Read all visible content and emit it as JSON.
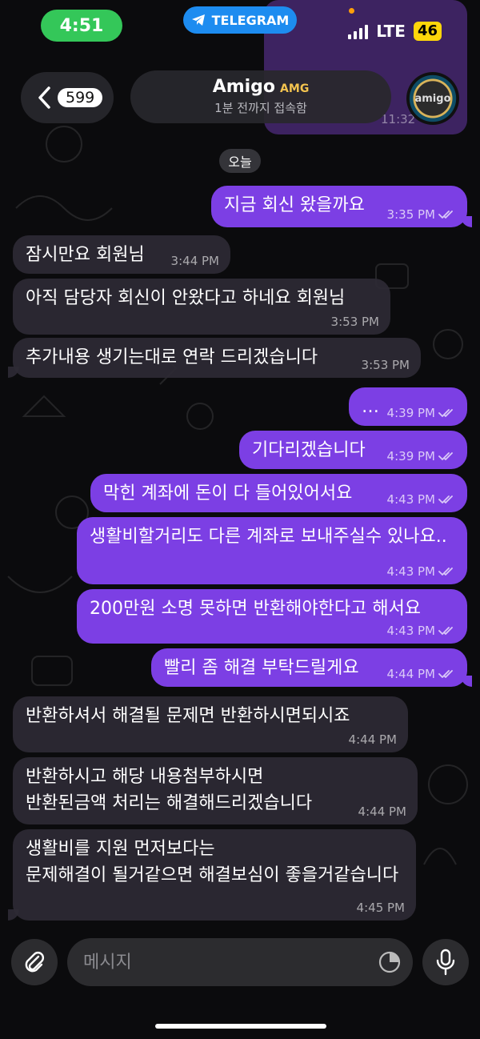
{
  "status_bar": {
    "time": "4:51",
    "app_indicator": "TELEGRAM",
    "network": "LTE",
    "battery": "46"
  },
  "header": {
    "back_count": "599",
    "title": "Amigo",
    "badge": "AMG",
    "subtitle": "1분 전까지 접속함",
    "avatar_text": "amigo"
  },
  "background_preview_time": "11:32",
  "date_label": "오늘",
  "messages": [
    {
      "dir": "out",
      "text": "지금 회신 왔을까요",
      "time": "3:35 PM",
      "read": true
    },
    {
      "dir": "in",
      "text": "잠시만요 회원님",
      "time": "3:44 PM"
    },
    {
      "dir": "in",
      "text": "아직 담당자 회신이 안왔다고 하네요 회원님",
      "time": "3:53 PM"
    },
    {
      "dir": "in",
      "text": "추가내용 생기는대로 연락 드리겠습니다",
      "time": "3:53 PM"
    },
    {
      "dir": "out",
      "text": "…",
      "time": "4:39 PM",
      "read": true
    },
    {
      "dir": "out",
      "text": "기다리겠습니다",
      "time": "4:39 PM",
      "read": true
    },
    {
      "dir": "out",
      "text": "막힌 계좌에 돈이 다 들어있어서요",
      "time": "4:43 PM",
      "read": true
    },
    {
      "dir": "out",
      "text": "생활비할거리도 다른 계좌로 보내주실수 있나요..",
      "time": "4:43 PM",
      "read": true
    },
    {
      "dir": "out",
      "text": "200만원 소명 못하면 반환해야한다고 해서요",
      "time": "4:43 PM",
      "read": true
    },
    {
      "dir": "out",
      "text": "빨리 좀 해결 부탁드릴게요",
      "time": "4:44 PM",
      "read": true
    },
    {
      "dir": "in",
      "text": "반환하셔서 해결될 문제면 반환하시면되시죠",
      "time": "4:44 PM"
    },
    {
      "dir": "in",
      "text": "반환하시고 해당 내용첨부하시면\n반환된금액 처리는 해결해드리겠습니다",
      "time": "4:44 PM"
    },
    {
      "dir": "in",
      "text": "생활비를 지원 먼저보다는\n문제해결이 될거같으면 해결보심이 좋을거같습니다",
      "time": "4:45 PM"
    }
  ],
  "composer": {
    "placeholder": "메시지"
  },
  "icons": {
    "back": "chevron-left-icon",
    "attach": "paperclip-icon",
    "sticker": "sticker-icon",
    "mic": "microphone-icon",
    "read": "double-check-icon",
    "telegram": "telegram-plane-icon"
  },
  "colors": {
    "outgoing_bubble": "#7c3fe4",
    "incoming_bubble": "#2e2a34",
    "status_time_pill": "#34c759",
    "telegram_pill": "#1d8cf0",
    "battery": "#ffd60a"
  }
}
